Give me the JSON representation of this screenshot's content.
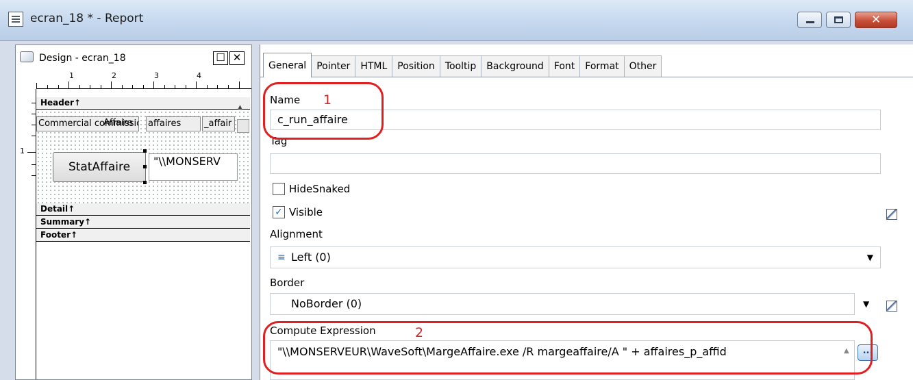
{
  "window": {
    "title": "ecran_18 * - Report",
    "close_glyph": "✕"
  },
  "design_pane": {
    "title": "Design - ecran_18",
    "restore_glyph": "☐",
    "close_glyph": "✕",
    "ruler_marks": [
      "1",
      "2",
      "3",
      "4"
    ],
    "vruler_mark": "1",
    "bands": {
      "header": "Header↑",
      "detail": "Detail↑",
      "summary": "Summary↑",
      "footer": "Footer↑"
    },
    "header_fields": [
      "Commercial commissions",
      "Affaire",
      "affaires",
      "_affair"
    ],
    "button_label": "StatAffaire",
    "compute_field_text": "\"\\\\MONSERV"
  },
  "properties": {
    "tabs": [
      "General",
      "Pointer",
      "HTML",
      "Position",
      "Tooltip",
      "Background",
      "Font",
      "Format",
      "Other"
    ],
    "active_tab": "General",
    "name_label": "Name",
    "name_value": "c_run_affaire",
    "tag_label": "Tag",
    "tag_value": "",
    "hidesnaked_label": "HideSnaked",
    "hidesnaked_checked": false,
    "visible_label": "Visible",
    "visible_checked": true,
    "check_glyph": "✓",
    "alignment_label": "Alignment",
    "alignment_icon": "align-left-icon",
    "alignment_value": "Left (0)",
    "border_label": "Border",
    "border_value": "NoBorder (0)",
    "compute_label": "Compute Expression",
    "compute_value": "\"\\\\MONSERVEUR\\WaveSoft\\MargeAffaire.exe /R margeaffaire/A \"  + affaires_p_affid",
    "ellipsis": "..."
  },
  "annotations": {
    "one": "1",
    "two": "2",
    "color": "#e02020"
  }
}
